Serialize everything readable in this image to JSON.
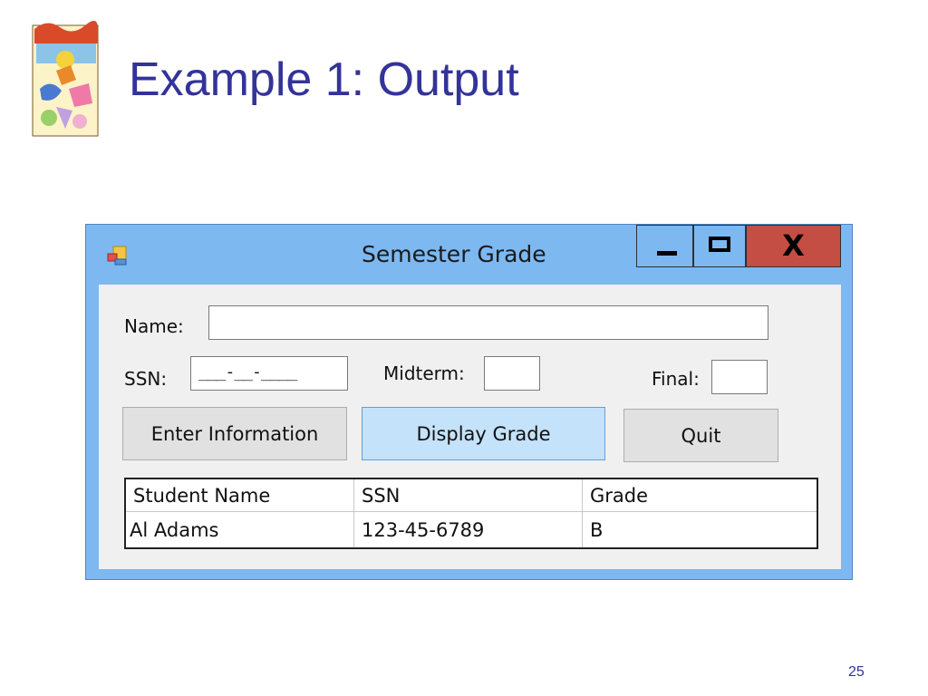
{
  "slide": {
    "title": "Example 1: Output",
    "page_number": "25"
  },
  "window": {
    "title": "Semester Grade",
    "close_glyph": "X",
    "icons": [
      "app-icon",
      "minimize-icon",
      "maximize-icon",
      "close-icon"
    ]
  },
  "form": {
    "name_label": "Name:",
    "name_value": "",
    "ssn_label": "SSN:",
    "ssn_mask": "___-__-____",
    "midterm_label": "Midterm:",
    "midterm_value": "",
    "final_label": "Final:",
    "final_value": ""
  },
  "buttons": {
    "enter": "Enter Information",
    "display": "Display Grade",
    "quit": "Quit"
  },
  "grid": {
    "columns": [
      "Student Name",
      "SSN",
      "Grade"
    ],
    "rows": [
      [
        "Al Adams",
        "123-45-6789",
        "B"
      ]
    ]
  },
  "colors": {
    "title_blue": "#333399",
    "window_frame": "#7db8f1",
    "close_red": "#c44e44",
    "display_button": "#c4e2f9"
  }
}
